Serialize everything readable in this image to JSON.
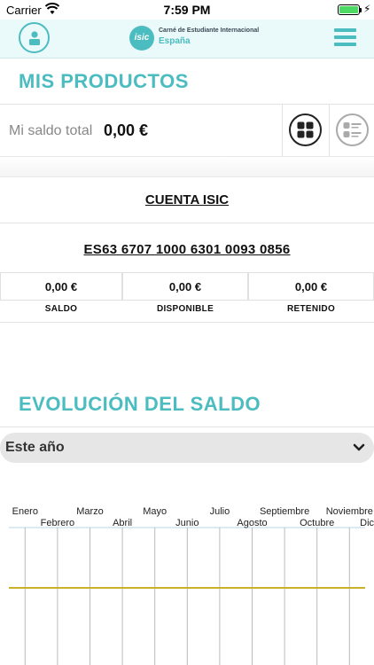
{
  "status_bar": {
    "carrier": "Carrier",
    "time": "7:59 PM"
  },
  "nav": {
    "logo_line1": "Carné de Estudiante Internacional",
    "logo_line2": "España",
    "logo_seal": "isic"
  },
  "products": {
    "title": "MIS PRODUCTOS",
    "total_label": "Mi saldo total",
    "total_value": "0,00 €"
  },
  "account": {
    "name": "CUENTA ISIC",
    "iban": "ES63 6707 1000 6301 0093 0856",
    "amounts": [
      {
        "value": "0,00 €",
        "label": "SALDO"
      },
      {
        "value": "0,00 €",
        "label": "DISPONIBLE"
      },
      {
        "value": "0,00 €",
        "label": "RETENIDO"
      }
    ]
  },
  "evolution": {
    "title": "EVOLUCIÓN DEL SALDO",
    "period_selected": "Este año"
  },
  "colors": {
    "accent": "#4bbcc0",
    "series": "#c9b22a",
    "grid": "#bbbbbb"
  },
  "icons": [
    "wifi-icon",
    "battery-icon",
    "profile-icon",
    "menu-icon",
    "grid-view-icon",
    "list-view-icon",
    "chevron-down-icon"
  ],
  "chart_data": {
    "type": "line",
    "categories": [
      "Enero",
      "Febrero",
      "Marzo",
      "Abril",
      "Mayo",
      "Junio",
      "Julio",
      "Agosto",
      "Septiembre",
      "Octubre",
      "Noviembre",
      "Diciembre"
    ],
    "series": [
      {
        "values": [
          0,
          0,
          0,
          0,
          0,
          0,
          0,
          0,
          0,
          0,
          0,
          0
        ]
      }
    ],
    "title": "",
    "xlabel": "",
    "ylabel": "",
    "x_axis_position": "top",
    "grid": true
  }
}
